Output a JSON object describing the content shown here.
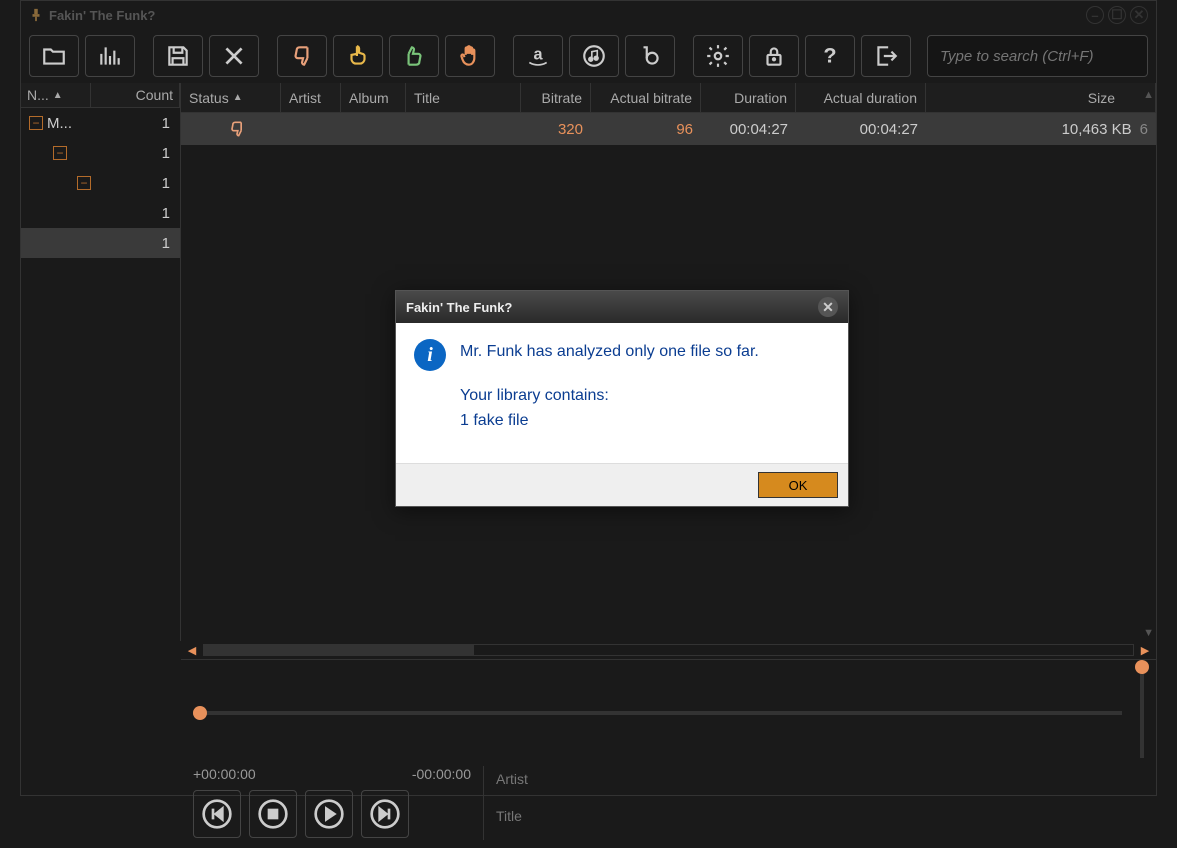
{
  "app_title": "Fakin' The Funk?",
  "search_placeholder": "Type to search (Ctrl+F)",
  "sidebar": {
    "columns": {
      "name": "N...",
      "count": "Count"
    },
    "rows": [
      {
        "indent": 0,
        "expander": true,
        "label": "M...",
        "count": "1"
      },
      {
        "indent": 1,
        "expander": true,
        "label": "",
        "count": "1"
      },
      {
        "indent": 2,
        "expander": true,
        "label": "",
        "count": "1"
      },
      {
        "indent": 3,
        "expander": false,
        "label": "",
        "count": "1"
      },
      {
        "indent": 0,
        "expander": false,
        "label": "",
        "count": "1",
        "selected": true
      }
    ]
  },
  "grid": {
    "columns": {
      "status": "Status",
      "artist": "Artist",
      "album": "Album",
      "title": "Title",
      "bitrate": "Bitrate",
      "actual": "Actual bitrate",
      "duration": "Duration",
      "actual_duration": "Actual duration",
      "size": "Size"
    },
    "rows": [
      {
        "status_icon": "thumbs-down",
        "artist": "",
        "album": "",
        "title": "",
        "bitrate": "320",
        "actual": "96",
        "duration": "00:04:27",
        "actual_duration": "00:04:27",
        "size": "10,463 KB",
        "extra": "6"
      }
    ]
  },
  "player": {
    "elapsed": "+00:00:00",
    "remaining": "-00:00:00",
    "artist_label": "Artist",
    "title_label": "Title"
  },
  "dialog": {
    "title": "Fakin' The Funk?",
    "line1": "Mr. Funk has analyzed only one file so far.",
    "line2": "Your library contains:",
    "line3": "1 fake file",
    "ok": "OK"
  }
}
